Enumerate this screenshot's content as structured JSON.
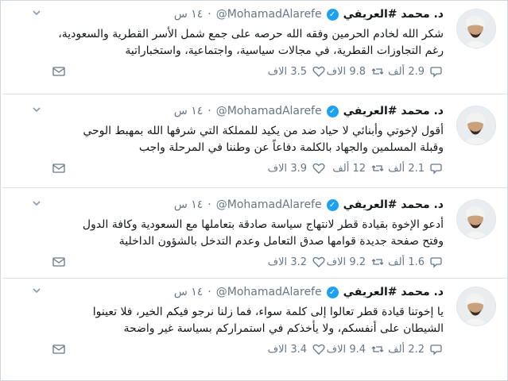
{
  "tweets": [
    {
      "name": "د. محمد #العريفي",
      "handle": "@MohamadAlarefe",
      "time": "١٤ س",
      "text_line1": "شكر الله لخادم الحرمين وفقه الله حرصه على جمع شمل الأسر القطرية والسعودية،",
      "text_line2": "رغم التجاوزات القطرية، في مجالات سياسية، واجتماعية، واستخباراتية",
      "replies": "2.9 ألف",
      "retweets": "9.8 الاف",
      "likes": "3.5 الاف"
    },
    {
      "name": "د. محمد #العريفي",
      "handle": "@MohamadAlarefe",
      "time": "١٤ س",
      "text_line1": "أقول لإخوتي وأبنائي لا حياد ضد من يكيد للمملكة التي شرفها الله بمهبط الوحي",
      "text_line2": "وقبلة المسلمين والجهاد بالكلمة دفاعاً عن وطننا في المرحلة واجب",
      "replies": "2.1 ألف",
      "retweets": "12 ألف",
      "likes": "3.9 الاف"
    },
    {
      "name": "د. محمد #العريفي",
      "handle": "@MohamadAlarefe",
      "time": "١٤ س",
      "text_line1": "أدعو الإخوة بقيادة قطر لانتهاج سياسة صادقة بتعاملها مع السعودية وكافة الدول",
      "text_line2": "وفتح صفحة جديدة قوامها صدق التعامل وعدم التدخل بالشؤون الداخلية",
      "replies": "1.6 ألف",
      "retweets": "9.2 الاف",
      "likes": "3.2 الاف"
    },
    {
      "name": "د. محمد #العريفي",
      "handle": "@MohamadAlarefe",
      "time": "١٤ س",
      "text_line1": "يا إخوتنا قيادة قطر تعالوا إلى كلمة سواء، فما زلنا نرجو فيكم الخير، فلا تعينوا",
      "text_line2": "الشيطان على أنفسكم، ولا يأخذكم في استمراركم بسياسة غير واضحة",
      "replies": "2.2 ألف",
      "retweets": "9.4 الاف",
      "likes": "3.4 الاف"
    }
  ],
  "icons": {
    "reply": "reply-icon",
    "retweet": "retweet-icon",
    "like": "heart-icon",
    "message": "mail-icon",
    "more": "chevron-down-icon",
    "verified": "verified-badge-icon"
  },
  "colors": {
    "verified": "#1da1f2",
    "secondary_text": "#657786",
    "divider": "#d9dfe4"
  }
}
